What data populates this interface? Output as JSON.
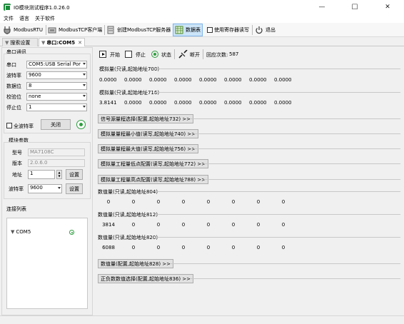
{
  "window": {
    "title": "IO模块测试程序1.0.26.0",
    "minimize": "—",
    "maximize": "☐",
    "close": "✕"
  },
  "menu": [
    "文件",
    "语言",
    "关于软件"
  ],
  "toolbar": {
    "modbus_rtu": "ModbusRTU",
    "modbus_tcp_client": "ModbusTCP客户端",
    "modbus_tcp_server": "创建ModbusTCP服务器",
    "data_table": "数据表",
    "use_register_read": "使用寄存器读写",
    "exit": "退出"
  },
  "tabs": [
    {
      "label": "搜索设置"
    },
    {
      "label": "串口:COM5"
    }
  ],
  "serial": {
    "group_title": "串口通讯",
    "port_label": "串口",
    "port_value": "COM5:USB Serial Por",
    "baud_label": "波特率",
    "baud_value": "9600",
    "databits_label": "数据位",
    "databits_value": "8",
    "parity_label": "校验位",
    "parity_value": "none",
    "stopbits_label": "停止位",
    "stopbits_value": "1",
    "full_baud_label": "全波特率",
    "close_label": "关闭"
  },
  "module": {
    "group_title": "模块参数",
    "model_label": "型号",
    "model_value": "MA7108C",
    "version_label": "版本",
    "version_value": "2.0.6.0",
    "address_label": "地址",
    "address_value": "1",
    "baud_label": "波特率",
    "baud_value": "9600",
    "set_label": "设置"
  },
  "connections": {
    "title": "连接列表",
    "items": [
      {
        "name": "COM5"
      }
    ]
  },
  "control": {
    "start": "开始",
    "stop": "停止",
    "status": "状态",
    "disconnect": "断开",
    "reply_label": "回应次数:",
    "reply_count": "587"
  },
  "analog_700": {
    "title": "模拟量(只读,起始地址700)",
    "values": [
      "0.0000",
      "0.0000",
      "0.0000",
      "0.0000",
      "0.0000",
      "0.0000",
      "0.0000",
      "0.0000"
    ]
  },
  "analog_716": {
    "title": "模拟量(只读,起始地址716)",
    "values": [
      "3.8141",
      "0.0000",
      "0.0000",
      "0.0000",
      "0.0000",
      "0.0000",
      "0.0000",
      "0.0000"
    ]
  },
  "config_buttons": [
    "信号源量程选择(配置,起始地址732) >>",
    "模拟量量程最小值(读写,起始地址740) >>",
    "模拟量量程最大值(读写,起始地址756) >>",
    "模拟量工程量低点配置(读写,起始地址772) >>",
    "模拟量工程量高点配置(读写,起始地址788) >>"
  ],
  "digital_804": {
    "title": "数值量(只读,起始地址804)",
    "values": [
      "0",
      "0",
      "0",
      "0",
      "0",
      "0",
      "0",
      "0"
    ]
  },
  "digital_812": {
    "title": "数值量(只读,起始地址812)",
    "values": [
      "3814",
      "0",
      "0",
      "0",
      "0",
      "0",
      "0",
      "0"
    ]
  },
  "digital_820": {
    "title": "数值量(只读,起始地址820)",
    "values": [
      "6088",
      "0",
      "0",
      "0",
      "0",
      "0",
      "0",
      "0"
    ]
  },
  "bottom_buttons": [
    "数值量(配置,起始地址828) >>",
    "正负数数值选择(配置,起始地址836) >>"
  ],
  "colors": {
    "accent": "#1b8a3a",
    "status_green": "#2e9e3e"
  }
}
